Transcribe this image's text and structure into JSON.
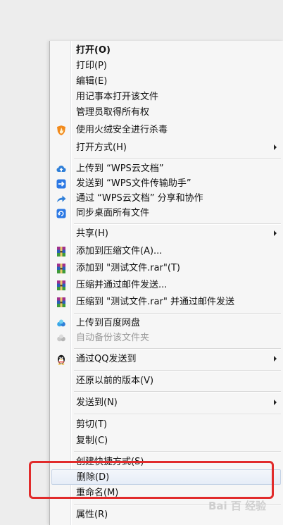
{
  "menu": {
    "items": [
      {
        "label": "打开(O)"
      },
      {
        "label": "打印(P)"
      },
      {
        "label": "编辑(E)"
      },
      {
        "label": "用记事本打开该文件"
      },
      {
        "label": "管理员取得所有权"
      },
      {
        "label": "使用火绒安全进行杀毒",
        "icon": "huorong-shield-icon"
      },
      {
        "label": "打开方式(H)"
      },
      {
        "label": "上传到 “WPS云文档”",
        "icon": "cloud-upload-icon"
      },
      {
        "label": "发送到 “WPS文件传输助手”",
        "icon": "send-arrow-icon"
      },
      {
        "label": "通过 “WPS云文档” 分享和协作",
        "icon": "share-icon"
      },
      {
        "label": "同步桌面所有文件",
        "icon": "sync-icon"
      },
      {
        "label": "共享(H)"
      },
      {
        "label": "添加到压缩文件(A)...",
        "icon": "winrar-icon"
      },
      {
        "label": "添加到 \"测试文件.rar\"(T)",
        "icon": "winrar-icon"
      },
      {
        "label": "压缩并通过邮件发送...",
        "icon": "winrar-icon"
      },
      {
        "label": "压缩到 \"测试文件.rar\" 并通过邮件发送",
        "icon": "winrar-icon"
      },
      {
        "label": "上传到百度网盘",
        "icon": "baidu-netdisk-icon"
      },
      {
        "label": "自动备份该文件夹",
        "icon": "baidu-backup-icon"
      },
      {
        "label": "通过QQ发送到",
        "icon": "qq-penguin-icon"
      },
      {
        "label": "还原以前的版本(V)"
      },
      {
        "label": "发送到(N)"
      },
      {
        "label": "剪切(T)"
      },
      {
        "label": "复制(C)"
      },
      {
        "label": "创建快捷方式(S)"
      },
      {
        "label": "删除(D)"
      },
      {
        "label": "重命名(M)"
      },
      {
        "label": "属性(R)"
      }
    ]
  },
  "watermark": {
    "text": "Bai 百 经验"
  },
  "colors": {
    "highlight_box": "#e12b2b",
    "menu_background": "#f6f6f6",
    "hover_background": "#e6edf7"
  }
}
